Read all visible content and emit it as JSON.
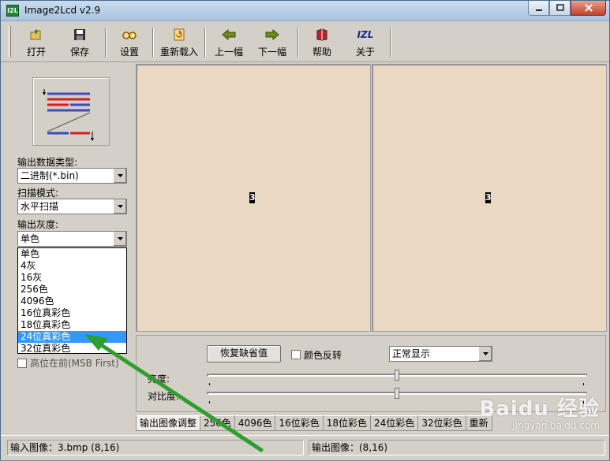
{
  "window": {
    "title": "Image2Lcd v2.9",
    "app_icon_text": "I2L"
  },
  "toolbar": {
    "items": [
      {
        "label": "打开",
        "icon": "open-folder-icon"
      },
      {
        "label": "保存",
        "icon": "save-disk-icon"
      },
      {
        "label": "设置",
        "icon": "glasses-settings-icon"
      },
      {
        "label": "重新载入",
        "icon": "reload-icon"
      },
      {
        "label": "上一幅",
        "icon": "arrow-left-icon"
      },
      {
        "label": "下一幅",
        "icon": "arrow-right-icon"
      },
      {
        "label": "帮助",
        "icon": "help-book-icon"
      },
      {
        "label": "关于",
        "icon": "about-izl-icon",
        "icon_text": "IZL"
      }
    ]
  },
  "settings": {
    "output_type_label": "输出数据类型:",
    "output_type_value": "二进制(*.bin)",
    "scan_mode_label": "扫描模式:",
    "scan_mode_value": "水平扫描",
    "gray_label": "输出灰度:",
    "gray_value": "单色",
    "gray_options": [
      "单色",
      "4灰",
      "16灰",
      "256色",
      "4096色",
      "16位真彩色",
      "18位真彩色",
      "24位真彩色",
      "32位真彩色"
    ],
    "gray_selected_index": 7,
    "msb_first_label": "高位在前(MSB First)",
    "msb_first_checked": false
  },
  "preview": {
    "input_glyph": "3",
    "output_glyph": "3"
  },
  "adjust": {
    "restore_button": "恢复缺省值",
    "invert_label": "颜色反转",
    "invert_checked": false,
    "display_mode_value": "正常显示",
    "brightness_label": "亮度:",
    "contrast_label": "对比度:",
    "brightness_value": 0.5,
    "contrast_value": 0.5
  },
  "tabs": [
    "输出图像调整",
    "256色",
    "4096色",
    "16位彩色",
    "18位彩色",
    "24位彩色",
    "32位彩色",
    "重新"
  ],
  "status": {
    "input": "输入图像：3.bmp (8,16)",
    "output": "输出图像：(8,16)"
  },
  "watermark": {
    "main": "Baidu 经验",
    "sub": "jingyan.baidu.com"
  },
  "colors": {
    "image_bg": "#ead8c2",
    "selection": "#3399ff",
    "annotation_arrow": "#2e9e2e"
  }
}
